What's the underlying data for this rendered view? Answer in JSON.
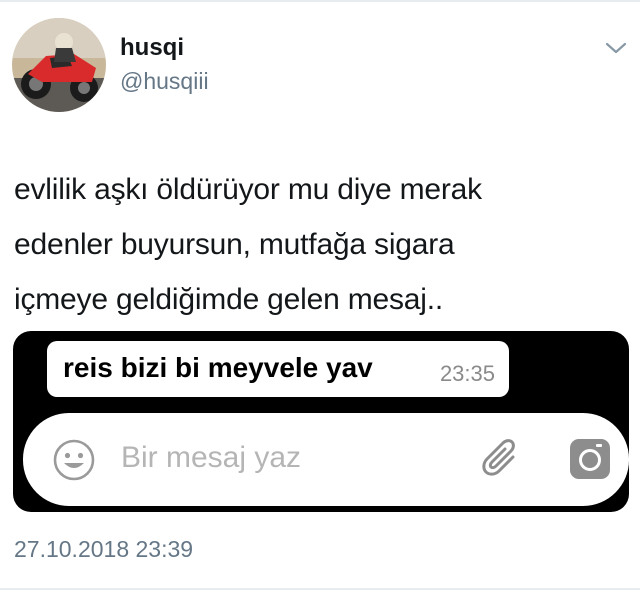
{
  "tweet": {
    "author": {
      "display_name": "husqi",
      "handle": "@husqiii",
      "avatar_icon": "motorcycle-rider-avatar"
    },
    "more_icon": "chevron-down-icon",
    "text_lines": [
      "evlilik aşkı öldürüyor mu diye merak",
      "edenler buyursun, mutfağa sigara",
      "içmeye geldiğimde gelen mesaj.."
    ],
    "timestamp": "27.10.2018 23:39"
  },
  "media": {
    "message": {
      "text": "reis bizi bi meyvele yav",
      "time": "23:35"
    },
    "input": {
      "placeholder": "Bir mesaj yaz",
      "emoji_icon": "smiley-icon",
      "attach_icon": "paperclip-icon",
      "camera_icon": "camera-icon"
    }
  },
  "colors": {
    "primary_text": "#14171a",
    "secondary_text": "#657786",
    "media_background": "#000000",
    "placeholder_text": "#b5b5b5"
  }
}
